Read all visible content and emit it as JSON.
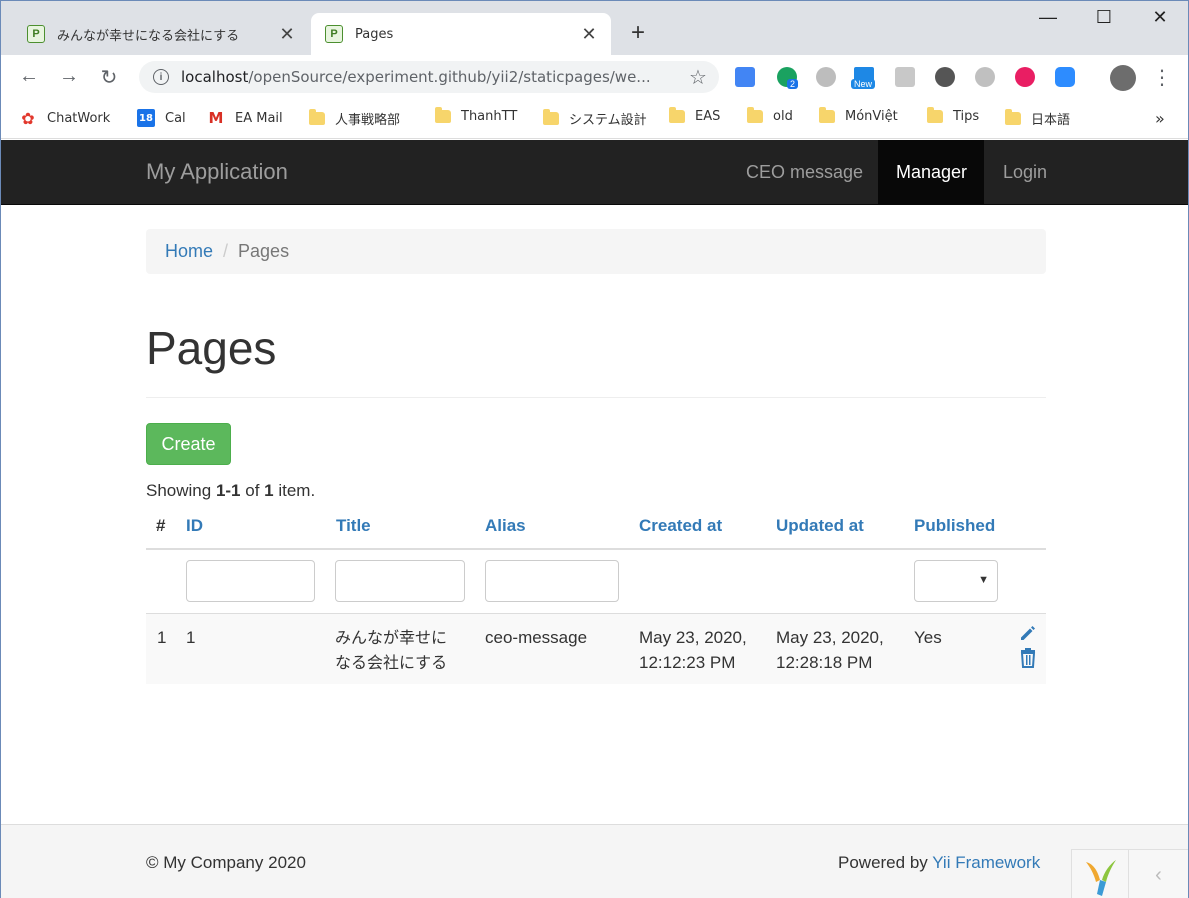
{
  "browser": {
    "tabs": [
      {
        "title": "みんなが幸せになる会社にする",
        "favicon": "P"
      },
      {
        "title": "Pages",
        "favicon": "P"
      }
    ],
    "new_tab": "+",
    "url_host": "localhost",
    "url_path": "/openSource/experiment.github/yii2/staticpages/we...",
    "bookmarks": [
      {
        "label": "ChatWork"
      },
      {
        "label": "Cal",
        "badge": "18"
      },
      {
        "label": "EA Mail"
      },
      {
        "label": "人事戦略部"
      },
      {
        "label": "ThanhTT"
      },
      {
        "label": "システム設計"
      },
      {
        "label": "EAS"
      },
      {
        "label": "old"
      },
      {
        "label": "MónViệt"
      },
      {
        "label": "Tips"
      },
      {
        "label": "日本語"
      }
    ],
    "more": "»",
    "ext_badge_count": "2",
    "ext_badge_new": "New"
  },
  "nav": {
    "brand": "My Application",
    "links": [
      "CEO message",
      "Manager",
      "Login"
    ]
  },
  "breadcrumb": {
    "home": "Home",
    "current": "Pages"
  },
  "page": {
    "title": "Pages",
    "create_label": "Create"
  },
  "summary": {
    "prefix": "Showing ",
    "range": "1-1",
    "mid": " of ",
    "total": "1",
    "suffix": " item."
  },
  "table": {
    "headers": [
      "#",
      "ID",
      "Title",
      "Alias",
      "Created at",
      "Updated at",
      "Published"
    ],
    "rows": [
      {
        "num": "1",
        "id": "1",
        "title_1": "みんなが幸せに",
        "title_2": "なる会社にする",
        "alias": "ceo-message",
        "created_1": "May 23, 2020,",
        "created_2": "12:12:23 PM",
        "updated_1": "May 23, 2020,",
        "updated_2": "12:28:18 PM",
        "published": "Yes"
      }
    ]
  },
  "footer": {
    "copyright": "© My Company 2020",
    "powered_prefix": "Powered by ",
    "powered_link": "Yii Framework"
  },
  "colors": {
    "navbar": "#222222",
    "link": "#337ab7",
    "success": "#5cb85c"
  }
}
